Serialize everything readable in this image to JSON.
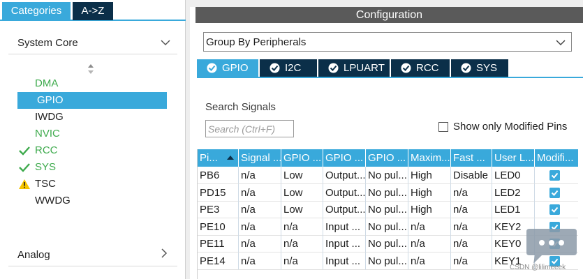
{
  "left_panel": {
    "tabs": {
      "categories": "Categories",
      "az": "A->Z"
    },
    "system_core": {
      "title": "System Core"
    },
    "analog": {
      "title": "Analog"
    },
    "items": [
      {
        "label": "DMA",
        "state": "configured",
        "icon": ""
      },
      {
        "label": "GPIO",
        "state": "selected",
        "icon": ""
      },
      {
        "label": "IWDG",
        "state": "default",
        "icon": ""
      },
      {
        "label": "NVIC",
        "state": "configured",
        "icon": ""
      },
      {
        "label": "RCC",
        "state": "configured",
        "icon": "green-check-icon"
      },
      {
        "label": "SYS",
        "state": "configured",
        "icon": "green-check-icon"
      },
      {
        "label": "TSC",
        "state": "warning",
        "icon": "warning-icon"
      },
      {
        "label": "WWDG",
        "state": "default",
        "icon": ""
      }
    ]
  },
  "config": {
    "header": "Configuration",
    "group_by": "Group By Peripherals",
    "tabs": [
      "GPIO",
      "I2C",
      "LPUART",
      "RCC",
      "SYS"
    ],
    "active_tab": "GPIO",
    "search_label": "Search Signals",
    "search_placeholder": "Search (Ctrl+F)",
    "show_modified_label": "Show only Modified Pins"
  },
  "table": {
    "columns": [
      "Pi...",
      "Signal ...",
      "GPIO ...",
      "GPIO ...",
      "GPIO ...",
      "Maxim...",
      "Fast ...",
      "User L...",
      "Modifi..."
    ],
    "rows": [
      [
        "PB6",
        "n/a",
        "Low",
        "Output...",
        "No pul...",
        "High",
        "Disable",
        "LED0"
      ],
      [
        "PD15",
        "n/a",
        "Low",
        "Output...",
        "No pul...",
        "High",
        "n/a",
        "LED2"
      ],
      [
        "PE3",
        "n/a",
        "Low",
        "Output...",
        "No pul...",
        "High",
        "n/a",
        "LED1"
      ],
      [
        "PE10",
        "n/a",
        "n/a",
        "Input ...",
        "No pul...",
        "n/a",
        "n/a",
        "KEY2"
      ],
      [
        "PE11",
        "n/a",
        "n/a",
        "Input ...",
        "No pul...",
        "n/a",
        "n/a",
        "KEY0"
      ],
      [
        "PE14",
        "n/a",
        "n/a",
        "Input ...",
        "No pul...",
        "n/a",
        "n/a",
        "KEY1"
      ]
    ],
    "modified": [
      true,
      true,
      true,
      true,
      true,
      true
    ]
  },
  "watermark": "CSDN @lilimeeek",
  "colors": {
    "accent": "#39a9db",
    "dark_tab": "#0b2f49",
    "header_gray": "#5a5a5a",
    "green": "#3daa4c",
    "warning": "#f5c400"
  }
}
